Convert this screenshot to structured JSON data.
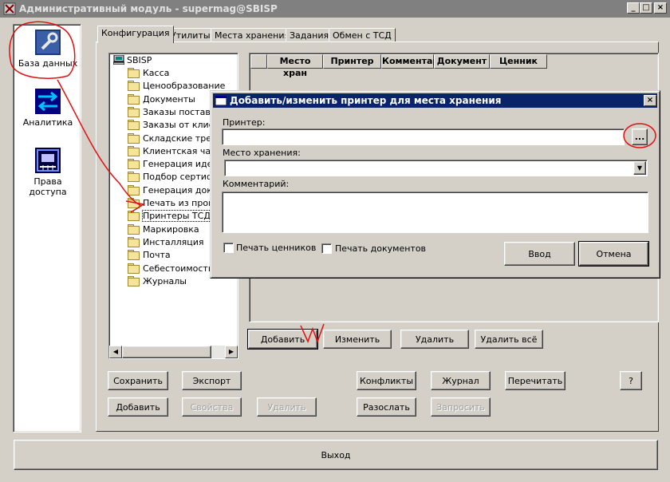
{
  "window": {
    "title": "Административный модуль - supermag@SBISP"
  },
  "sidebar": {
    "items": [
      {
        "label": "База данных",
        "icon": "wrench-icon"
      },
      {
        "label": "Аналитика",
        "icon": "arrows-icon"
      },
      {
        "label": "Права доступа",
        "icon": "access-rights-icon"
      }
    ]
  },
  "tabs": [
    "Конфигурация",
    "Утилиты",
    "Места хранения",
    "Задания",
    "Обмен с ТСД"
  ],
  "tree": {
    "root": "SBISP",
    "items": [
      "Касса",
      "Ценообразование",
      "Документы",
      "Заказы постави",
      "Заказы от клиен",
      "Складские требо",
      "Клиентская част",
      "Генерация идент",
      "Подбор сертифи",
      "Генерация доку",
      "Печать из проце",
      "Принтеры ТСД",
      "Маркировка",
      "Инсталляция",
      "Почта",
      "Себестоимость",
      "Журналы"
    ]
  },
  "grid": {
    "columns": [
      "Место хран",
      "Принтер",
      "Комментар",
      "Документ",
      "Ценник"
    ]
  },
  "grid_buttons": {
    "add": "Добавить",
    "edit": "Изменить",
    "delete": "Удалить",
    "delete_all": "Удалить всё"
  },
  "bottom_buttons": {
    "save": "Сохранить",
    "export": "Экспорт",
    "add": "Добавить",
    "properties": "Свойства",
    "delete": "Удалить",
    "conflicts": "Конфликты",
    "journal": "Журнал",
    "reread": "Перечитать",
    "help": "?",
    "send": "Разослать",
    "request": "Запросить"
  },
  "exit_label": "Выход",
  "dialog": {
    "title": "Добавить/изменить принтер для места хранения",
    "printer_label": "Принтер:",
    "printer_value": "",
    "browse_label": "...",
    "storage_label": "Место хранения:",
    "storage_value": "",
    "comment_label": "Комментарий:",
    "comment_value": "",
    "print_labels_label": "Печать ценников",
    "print_docs_label": "Печать документов",
    "ok_label": "Ввод",
    "cancel_label": "Отмена"
  }
}
